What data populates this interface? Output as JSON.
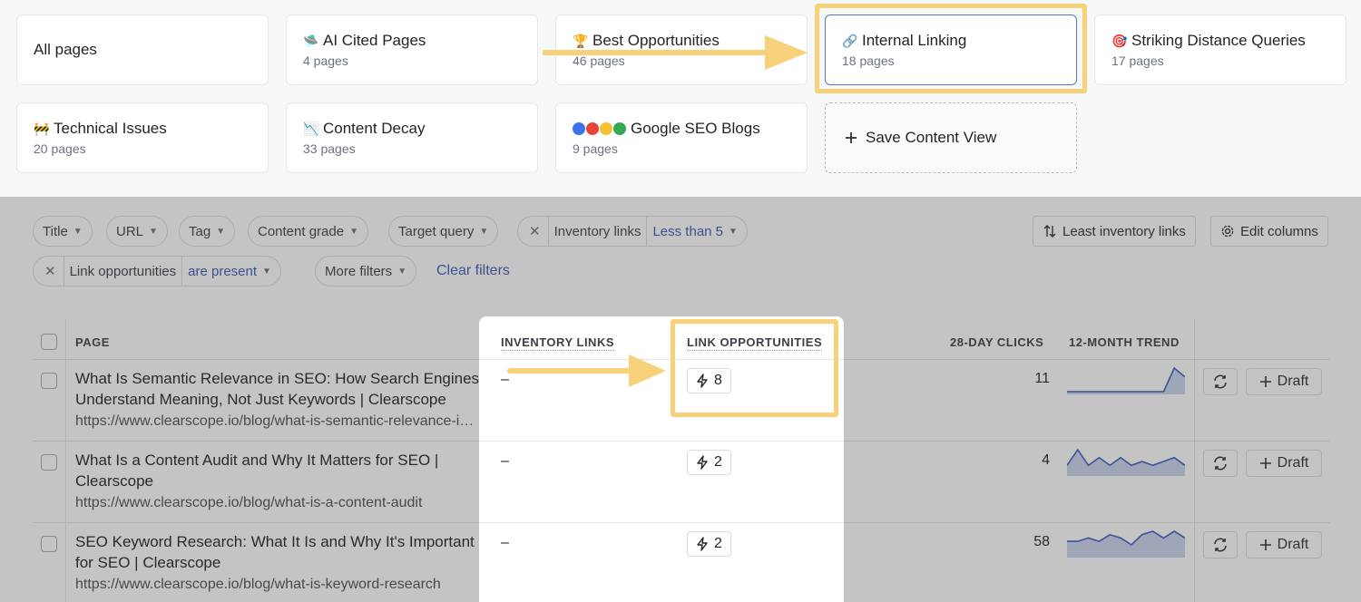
{
  "views": [
    {
      "icon": "",
      "title": "All pages",
      "subtitle": ""
    },
    {
      "icon": "🛸",
      "title": "AI Cited Pages",
      "subtitle": "4 pages"
    },
    {
      "icon": "🏆",
      "title": "Best Opportunities",
      "subtitle": "46 pages"
    },
    {
      "icon": "🔗",
      "title": "Internal Linking",
      "subtitle": "18 pages"
    },
    {
      "icon": "🎯",
      "title": "Striking Distance Queries",
      "subtitle": "17 pages"
    },
    {
      "icon": "🚧",
      "title": "Technical Issues",
      "subtitle": "20 pages"
    },
    {
      "icon": "📉",
      "title": "Content Decay",
      "subtitle": "33 pages"
    },
    {
      "icon": "",
      "title": "Google SEO Blogs",
      "subtitle": "9 pages"
    }
  ],
  "google_dots": [
    "#3a73e8",
    "#e8433a",
    "#f8c12c",
    "#35a853"
  ],
  "save_view_label": "Save Content View",
  "filters": {
    "title": "Title",
    "url": "URL",
    "tag": "Tag",
    "content_grade": "Content grade",
    "target_query": "Target query",
    "inventory_label": "Inventory links",
    "inventory_value": "Less than 5",
    "link_opp_label": "Link opportunities",
    "link_opp_value": "are present",
    "more_filters": "More filters",
    "clear_filters": "Clear filters"
  },
  "toolbar": {
    "sort_label": "Least inventory links",
    "edit_columns": "Edit columns"
  },
  "columns": {
    "page": "PAGE",
    "inventory_links": "INVENTORY LINKS",
    "link_opportunities": "LINK OPPORTUNITIES",
    "clicks": "28-DAY CLICKS",
    "trend": "12-MONTH TREND"
  },
  "rows": [
    {
      "title": "What Is Semantic Relevance in SEO: How Search Engines Understand Meaning, Not Just Keywords | Clearscope",
      "url": "https://www.clearscope.io/blog/what-is-semantic-relevance-in-seo",
      "inventory": "–",
      "opportunities": "8",
      "clicks": "11",
      "trend": [
        0,
        0,
        0,
        0,
        0,
        0,
        0,
        0,
        0,
        0,
        8,
        5
      ]
    },
    {
      "title": "What Is a Content Audit and Why It Matters for SEO | Clearscope",
      "url": "https://www.clearscope.io/blog/what-is-a-content-audit",
      "inventory": "–",
      "opportunities": "2",
      "clicks": "4",
      "trend": [
        2,
        6,
        2,
        4,
        2,
        4,
        2,
        3,
        2,
        3,
        4,
        2
      ]
    },
    {
      "title": "SEO Keyword Research: What It Is and Why It's Important for SEO | Clearscope",
      "url": "https://www.clearscope.io/blog/what-is-keyword-research",
      "inventory": "–",
      "opportunities": "2",
      "clicks": "58",
      "trend": [
        4,
        4,
        5,
        4,
        6,
        5,
        3,
        6,
        7,
        5,
        7,
        5
      ]
    }
  ],
  "draft_label": "Draft",
  "colors": {
    "highlight": "#f8d27a",
    "accent": "#3b5bb5",
    "trend": "#3d5fbf"
  }
}
